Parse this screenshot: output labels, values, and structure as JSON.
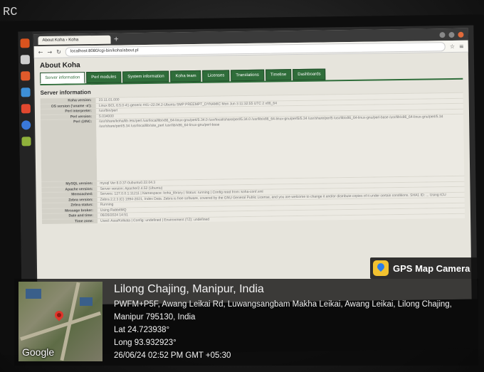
{
  "overlay_corner": "RC",
  "browser": {
    "tab_title": "About Koha › Koha",
    "url": "localhost:8080/cgi-bin/koha/about.pl"
  },
  "koha": {
    "page_title": "About Koha",
    "tabs": [
      "Server information",
      "Perl modules",
      "System information",
      "Koha team",
      "Licenses",
      "Translations",
      "Timeline",
      "Dashboards"
    ],
    "section_title": "Server information",
    "rows": [
      {
        "k": "Koha version:",
        "v": "23.11.01.000"
      },
      {
        "k": "OS version ('uname -a'):",
        "v": "Linux BCL 6.5.0-41-generic #41~22.04.2-Ubuntu SMP PREEMPT_DYNAMIC Mon Jun 3 11:32:55 UTC 2 x86_64"
      },
      {
        "k": "Perl interpreter:",
        "v": "/usr/bin/perl"
      },
      {
        "k": "Perl version:",
        "v": "5.034000"
      },
      {
        "k": "Perl @INC:",
        "v": "/usr/share/koha/lib /etc/perl /usr/local/lib/x86_64-linux-gnu/perl/5.34.0 /usr/local/share/perl/5.34.0 /usr/lib/x86_64-linux-gnu/perl5/5.34 /usr/share/perl5 /usr/lib/x86_64-linux-gnu/perl-base /usr/lib/x86_64-linux-gnu/perl/5.34 /usr/share/perl/5.34 /usr/local/lib/site_perl /usr/lib/x86_64-linux-gnu/perl-base"
      },
      {
        "k": "MySQL version:",
        "v": "mysql Ver 8.0.37-0ubuntu0.22.04.3"
      },
      {
        "k": "Apache version:",
        "v": "Server version: Apache/2.4.52 (Ubuntu)"
      },
      {
        "k": "Memcached:",
        "v": "Servers: 127.0.0.1:11211 | Namespace: koha_library | Status: running | Config read from: koha-conf.xml"
      },
      {
        "k": "Zebra version:",
        "v": "Zebra 2.2.3 (C) 1994-2021, Index Data. Zebra is free software, covered by the GNU General Public License, and you are welcome to change it and/or distribute copies of it under certain conditions. SHA1 ID: ... Using ICU"
      },
      {
        "k": "Zebra status:",
        "v": "Running"
      },
      {
        "k": "Message broker:",
        "v": "Using RabbitMQ"
      },
      {
        "k": "Date and time:",
        "v": "06/26/2024 14:51"
      },
      {
        "k": "Time zone:",
        "v": "Used: Asia/Kolkata | Config: undefined | Environment (TZ): undefined"
      }
    ]
  },
  "gps": {
    "brand": "GPS Map Camera",
    "map_attribution": "Google",
    "location_title": "Lilong Chajing, Manipur, India",
    "address": "PWFM+P5F, Awang Leikai Rd, Luwangsangbam Makha Leikai, Awang Leikai, Lilong Chajing, Manipur 795130, India",
    "lat": "Lat 24.723938°",
    "long": "Long 93.932923°",
    "datetime": "26/06/24 02:52 PM GMT +05:30"
  }
}
